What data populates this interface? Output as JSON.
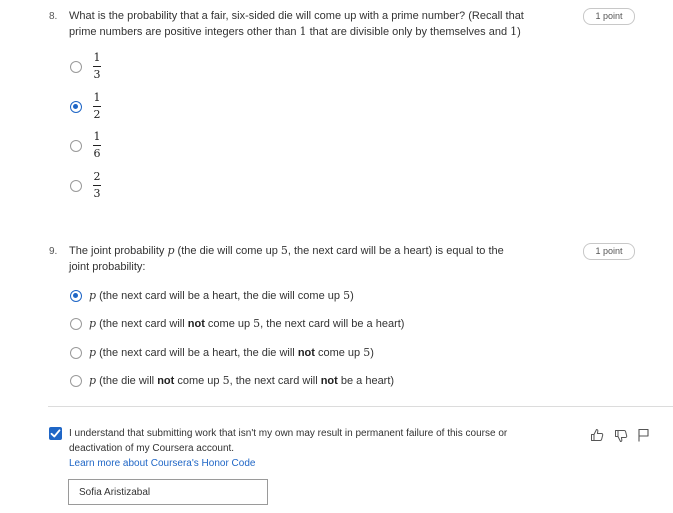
{
  "q8": {
    "number": "8.",
    "text_line1": "What is the probability that a fair, six-sided die will come up with a prime number? (Recall that",
    "text_line2_a": "prime numbers are positive integers other than ",
    "text_line2_b": "1",
    "text_line2_c": " that are divisible only by themselves and ",
    "text_line2_d": "1",
    "text_line2_e": ")",
    "points": "1 point",
    "options": [
      {
        "numerator": "1",
        "denominator": "3",
        "checked": false
      },
      {
        "numerator": "1",
        "denominator": "2",
        "checked": true
      },
      {
        "numerator": "1",
        "denominator": "6",
        "checked": false
      },
      {
        "numerator": "2",
        "denominator": "3",
        "checked": false
      }
    ]
  },
  "q9": {
    "number": "9.",
    "text_a": "The joint probability ",
    "text_p": "p",
    "text_b": " (the die will come up ",
    "text_5": "5",
    "text_c": ", the next card will be a heart) is equal to the",
    "text_line2": "joint probability:",
    "points": "1 point",
    "options": [
      {
        "p": "p",
        "a": " (the next card will be a heart, the die will come up ",
        "n": "5",
        "b": ")",
        "checked": true
      },
      {
        "p": "p",
        "a": " (the next card will ",
        "bold1": "not",
        "c": " come up ",
        "n": "5",
        "b": ", the next card will be a heart)",
        "checked": false
      },
      {
        "p": "p",
        "a": " (the next card will be a heart, the die will ",
        "bold1": "not",
        "c": " come up ",
        "n": "5",
        "b": ")",
        "checked": false
      },
      {
        "p": "p",
        "a": " (the die will ",
        "bold1": "not",
        "c": " come up ",
        "n": "5",
        "b": ", the next card will ",
        "bold2": "not",
        "d": " be a heart)",
        "checked": false
      }
    ]
  },
  "honor": {
    "checked": true,
    "text": "I understand that submitting work that isn't my own may result in permanent failure of this course or deactivation of my Coursera account.",
    "link": "Learn more about Coursera's Honor Code",
    "name_value": "Sofia Aristizabal"
  },
  "icons": [
    "thumbs-up-icon",
    "thumbs-down-icon",
    "flag-icon"
  ],
  "colors": {
    "accent": "#1f66c6"
  }
}
